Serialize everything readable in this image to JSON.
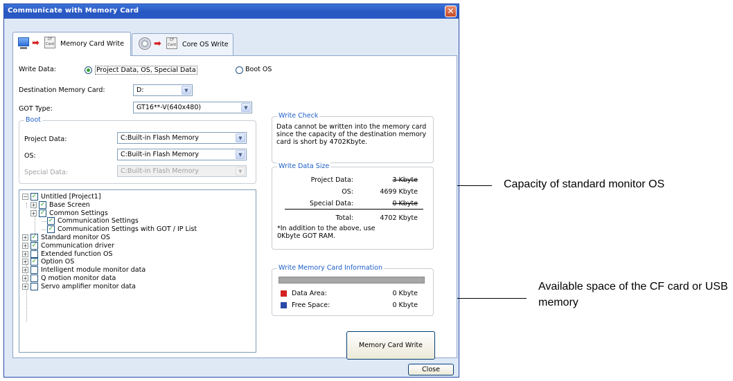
{
  "window": {
    "title": "Communicate with Memory Card",
    "close_glyph": "✕"
  },
  "tabs": [
    {
      "label": "Memory Card Write",
      "icons": [
        "monitor-icon",
        "red-arrow-icon",
        "cf-card-icon"
      ],
      "card_text": "CF Card"
    },
    {
      "label": "Core OS Write",
      "icons": [
        "core-os-icon",
        "red-arrow-icon",
        "cf-card-icon"
      ],
      "card_text": "CF Card"
    }
  ],
  "write_data": {
    "label": "Write Data:",
    "options": [
      "Project Data, OS, Special Data",
      "Boot OS"
    ],
    "selected": "Project Data, OS, Special Data"
  },
  "destination": {
    "label": "Destination Memory Card:",
    "value": "D:"
  },
  "got_type": {
    "label": "GOT Type:",
    "value": "GT16**-V(640x480)"
  },
  "boot": {
    "title": "Boot",
    "project_data": {
      "label": "Project Data:",
      "value": "C:Built-in Flash Memory"
    },
    "os": {
      "label": "OS:",
      "value": "C:Built-in Flash Memory"
    },
    "special_data": {
      "label": "Special Data:",
      "value": "C:Built-in Flash Memory"
    }
  },
  "tree": [
    {
      "label": "Untitled [Project1]",
      "checked": true,
      "expander": "-"
    },
    {
      "label": "Base Screen",
      "checked": true,
      "expander": "+"
    },
    {
      "label": "Common Settings",
      "checked": true,
      "expander": "+"
    },
    {
      "label": "Communication Settings",
      "checked": true,
      "expander": ""
    },
    {
      "label": "Communication Settings with GOT / IP List",
      "checked": true,
      "expander": ""
    },
    {
      "label": "Standard monitor OS",
      "checked": true,
      "expander": "+"
    },
    {
      "label": "Communication driver",
      "checked": true,
      "expander": "+"
    },
    {
      "label": "Extended function OS",
      "checked": false,
      "expander": "+"
    },
    {
      "label": "Option OS",
      "checked": true,
      "expander": "+"
    },
    {
      "label": "Intelligent module monitor data",
      "checked": false,
      "expander": "+"
    },
    {
      "label": "Q motion monitor data",
      "checked": false,
      "expander": "+"
    },
    {
      "label": "Servo amplifier monitor data",
      "checked": false,
      "expander": "+"
    }
  ],
  "write_check": {
    "title": "Write Check",
    "message": "Data cannot be written into the memory card since the capacity of the destination memory card is short by 4702Kbyte."
  },
  "write_data_size": {
    "title": "Write Data Size",
    "project_data": {
      "label": "Project Data:",
      "value": "3 Kbyte"
    },
    "os": {
      "label": "OS:",
      "value": "4699 Kbyte"
    },
    "special_data": {
      "label": "Special Data:",
      "value": "0 Kbyte"
    },
    "total": {
      "label": "Total:",
      "value": "4702 Kbyte"
    },
    "note": "*In addition to the above, use 0Kbyte GOT RAM."
  },
  "memory_info": {
    "title": "Write Memory Card Information",
    "data_area": {
      "label": "Data Area:",
      "value": "0 Kbyte",
      "color": "#d42020"
    },
    "free_space": {
      "label": "Free Space:",
      "value": "0 Kbyte",
      "color": "#2a4aa8"
    }
  },
  "buttons": {
    "memory_card_write": "Memory Card Write",
    "close": "Close"
  },
  "callouts": {
    "os_capacity": "Capacity of standard monitor OS",
    "available_space": "Available space of the CF card or USB memory"
  }
}
